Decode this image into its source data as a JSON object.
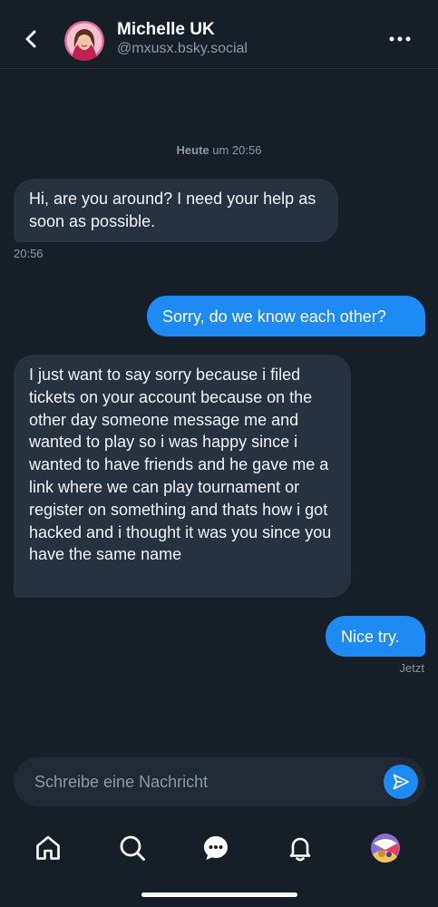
{
  "header": {
    "title": "Michelle UK",
    "handle": "@mxusx.bsky.social"
  },
  "chat": {
    "date_separator": {
      "day": "Heute",
      "rest": " um 20:56"
    },
    "messages": [
      {
        "from": "them",
        "text": "Hi, are you around? I need your help as soon as possible.",
        "time": "20:56"
      },
      {
        "from": "me",
        "text": "Sorry, do we know each other?"
      },
      {
        "from": "them",
        "text": "I just want to say sorry because i filed tickets on your account because on the other day someone message me and wanted to play so i was happy since i wanted to have friends and he gave me a link where we can play tournament or register on something and thats how i got hacked and i thought it was you since you have the same name"
      },
      {
        "from": "me",
        "text": "Nice try.",
        "time": "Jetzt"
      }
    ]
  },
  "composer": {
    "placeholder": "Schreibe eine Nachricht"
  },
  "nav": {
    "items": [
      {
        "icon": "home-icon"
      },
      {
        "icon": "search-icon"
      },
      {
        "icon": "chat-icon"
      },
      {
        "icon": "bell-icon"
      },
      {
        "icon": "avatar"
      }
    ]
  },
  "colors": {
    "background": "#161e27",
    "incoming_bubble": "#26323f",
    "outgoing_bubble": "#1e8bf5",
    "muted_text": "#8c99a8"
  }
}
